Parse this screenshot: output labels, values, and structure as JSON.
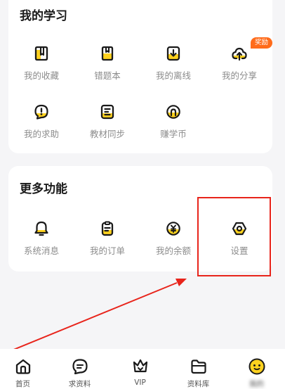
{
  "study": {
    "title": "我的学习",
    "items": [
      {
        "label": "我的收藏",
        "icon": "book-bookmark-icon"
      },
      {
        "label": "错题本",
        "icon": "notebook-icon"
      },
      {
        "label": "我的离线",
        "icon": "download-icon"
      },
      {
        "label": "我的分享",
        "icon": "cloud-share-icon",
        "badge": "奖励"
      },
      {
        "label": "我的求助",
        "icon": "help-bubble-icon"
      },
      {
        "label": "教材同步",
        "icon": "textbook-sync-icon"
      },
      {
        "label": "赚学币",
        "icon": "coin-icon"
      }
    ]
  },
  "more": {
    "title": "更多功能",
    "items": [
      {
        "label": "系统消息",
        "icon": "bell-icon"
      },
      {
        "label": "我的订单",
        "icon": "clipboard-icon"
      },
      {
        "label": "我的余额",
        "icon": "yuan-wallet-icon"
      },
      {
        "label": "设置",
        "icon": "hexagon-gear-icon"
      }
    ]
  },
  "tabs": [
    {
      "label": "首页",
      "icon": "home-icon"
    },
    {
      "label": "求资料",
      "icon": "chat-request-icon"
    },
    {
      "label": "VIP",
      "icon": "crown-icon"
    },
    {
      "label": "资料库",
      "icon": "folder-icon"
    },
    {
      "label": "我的",
      "icon": "smiley-avatar-icon"
    }
  ],
  "colors": {
    "accent_yellow": "#ffd21f",
    "icon_stroke": "#1a1a1a",
    "badge": "#ff6b1a",
    "annotation_red": "#e8241b"
  }
}
